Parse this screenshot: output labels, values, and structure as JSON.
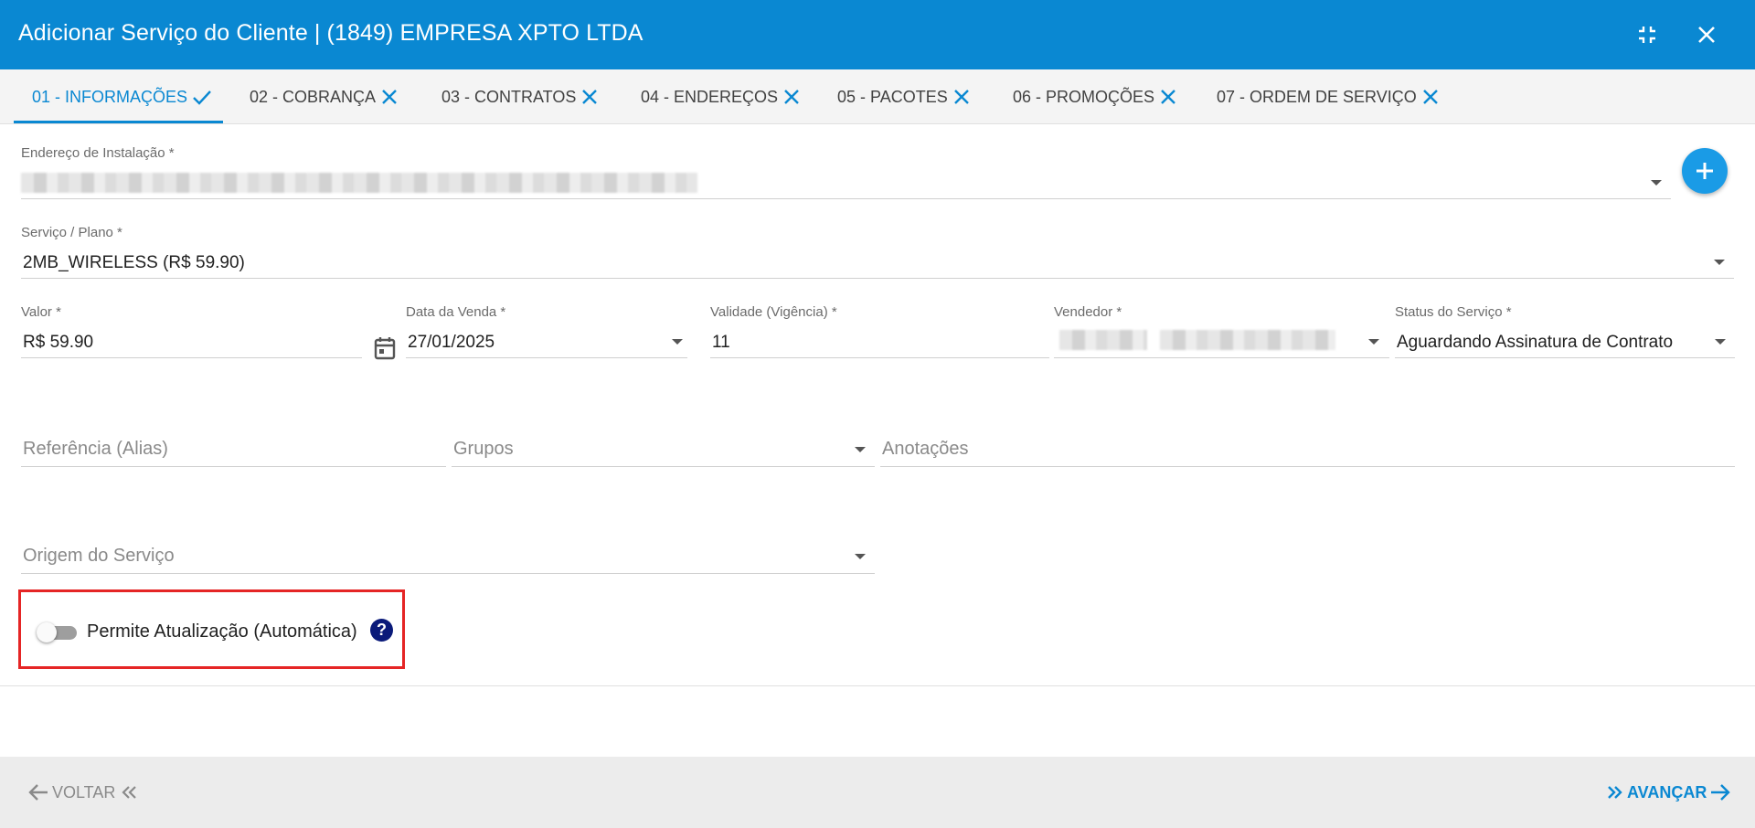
{
  "dialog": {
    "title": "Adicionar Serviço do Cliente | (1849) EMPRESA XPTO LTDA"
  },
  "tabs": [
    {
      "label": "01 - INFORMAÇÕES",
      "status": "check"
    },
    {
      "label": "02 - COBRANÇA",
      "status": "close"
    },
    {
      "label": "03 - CONTRATOS",
      "status": "close"
    },
    {
      "label": "04 - ENDEREÇOS",
      "status": "close"
    },
    {
      "label": "05 - PACOTES",
      "status": "close"
    },
    {
      "label": "06 - PROMOÇÕES",
      "status": "close"
    },
    {
      "label": "07 - ORDEM DE SERVIÇO",
      "status": "close"
    }
  ],
  "form": {
    "endereco": {
      "label": "Endereço de Instalação *"
    },
    "servico": {
      "label": "Serviço / Plano *",
      "value": "2MB_WIRELESS (R$ 59.90)"
    },
    "valor": {
      "label": "Valor *",
      "value": "R$ 59.90"
    },
    "data_venda": {
      "label": "Data da Venda *",
      "value": "27/01/2025"
    },
    "validade": {
      "label": "Validade (Vigência) *",
      "value": "11"
    },
    "vendedor": {
      "label": "Vendedor *"
    },
    "status": {
      "label": "Status do Serviço *",
      "value": "Aguardando Assinatura de Contrato"
    },
    "referencia": {
      "placeholder": "Referência (Alias)"
    },
    "grupos": {
      "placeholder": "Grupos"
    },
    "anotacoes": {
      "placeholder": "Anotações"
    },
    "origem": {
      "placeholder": "Origem do Serviço"
    },
    "atualizacao": {
      "label": "Permite Atualização (Automática)",
      "enabled": false,
      "help": "?"
    }
  },
  "footer": {
    "back_label": "VOLTAR",
    "next_label": "AVANÇAR"
  },
  "colors": {
    "primary": "#0a88d2",
    "highlight": "#e52525",
    "help": "#0a1a7a"
  }
}
